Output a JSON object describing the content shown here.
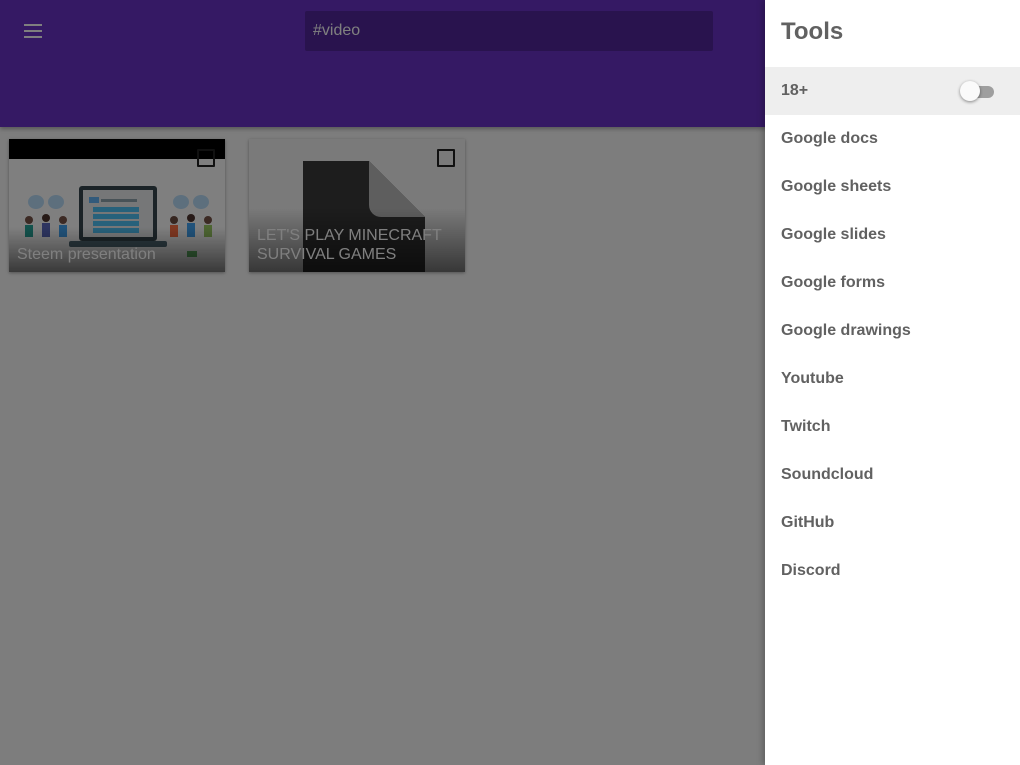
{
  "header": {
    "menu_icon": "hamburger-menu-icon",
    "search": {
      "value": "#video",
      "placeholder": "#video"
    },
    "accent_color": "#6a32c9"
  },
  "cards": [
    {
      "title": "Steem presentation",
      "thumbnail": "presentation-illustration",
      "checked": false
    },
    {
      "title": "LET'S PLAY MINECRAFT SURVIVAL GAMES",
      "thumbnail": "file-icon",
      "checked": false
    }
  ],
  "drawer": {
    "title": "Tools",
    "nsfw_toggle": {
      "label": "18+",
      "on": false
    },
    "items": [
      {
        "label": "Google docs"
      },
      {
        "label": "Google sheets"
      },
      {
        "label": "Google slides"
      },
      {
        "label": "Google forms"
      },
      {
        "label": "Google drawings"
      },
      {
        "label": "Youtube"
      },
      {
        "label": "Twitch"
      },
      {
        "label": "Soundcloud"
      },
      {
        "label": "GitHub"
      },
      {
        "label": "Discord"
      }
    ]
  }
}
